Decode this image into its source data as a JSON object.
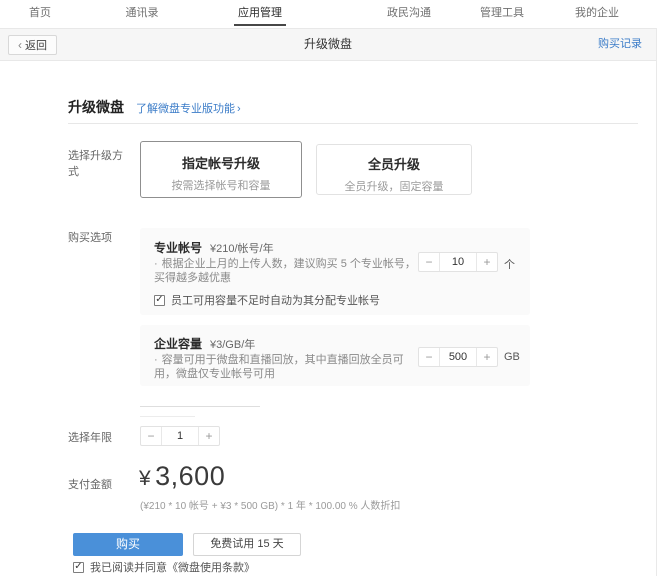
{
  "nav": {
    "tabs": [
      {
        "label": "首页"
      },
      {
        "label": "通讯录"
      },
      {
        "label": "应用管理"
      },
      {
        "label": "政民沟通"
      },
      {
        "label": "管理工具"
      },
      {
        "label": "我的企业"
      }
    ]
  },
  "header": {
    "back_chevron": "‹",
    "back_label": "返回",
    "title": "升级微盘",
    "records_link": "购买记录"
  },
  "page": {
    "title": "升级微盘",
    "learn_more": "了解微盘专业版功能",
    "learn_more_arrow": "›"
  },
  "upgrade_mode": {
    "label": "选择升级方式",
    "options": [
      {
        "title": "指定帐号升级",
        "desc": "按需选择帐号和容量"
      },
      {
        "title": "全员升级",
        "desc": "全员升级，固定容量"
      }
    ]
  },
  "purchase_options": {
    "label": "购买选项",
    "pro_account": {
      "title": "专业帐号",
      "price": "¥210/帐号/年",
      "desc": "根据企业上月的上传人数，建议购买 5 个专业帐号，买得越多越优惠",
      "qty": "10",
      "unit": "个",
      "auto_assign_label": "员工可用容量不足时自动为其分配专业帐号"
    },
    "capacity": {
      "title": "企业容量",
      "price": "¥3/GB/年",
      "desc": "容量可用于微盘和直播回放，其中直播回放全员可用，微盘仅专业帐号可用",
      "qty": "500",
      "unit": "GB"
    }
  },
  "years": {
    "label": "选择年限",
    "qty": "1"
  },
  "payment": {
    "label": "支付金额",
    "currency": "¥",
    "amount": "3,600",
    "formula": "(¥210 * 10 帐号 + ¥3 * 500 GB) * 1 年 * 100.00 % 人数折扣"
  },
  "footer": {
    "buy_label": "购买",
    "trial_label": "免费试用 15 天",
    "agree_label": "我已阅读并同意《微盘使用条款》"
  },
  "icons": {
    "minus": "−",
    "plus": "+",
    "check": "✓",
    "bullet": "·"
  },
  "colors": {
    "accent_blue": "#3b7cc8",
    "button_blue": "#4a90d9",
    "active_tab_underline": "#474747"
  }
}
